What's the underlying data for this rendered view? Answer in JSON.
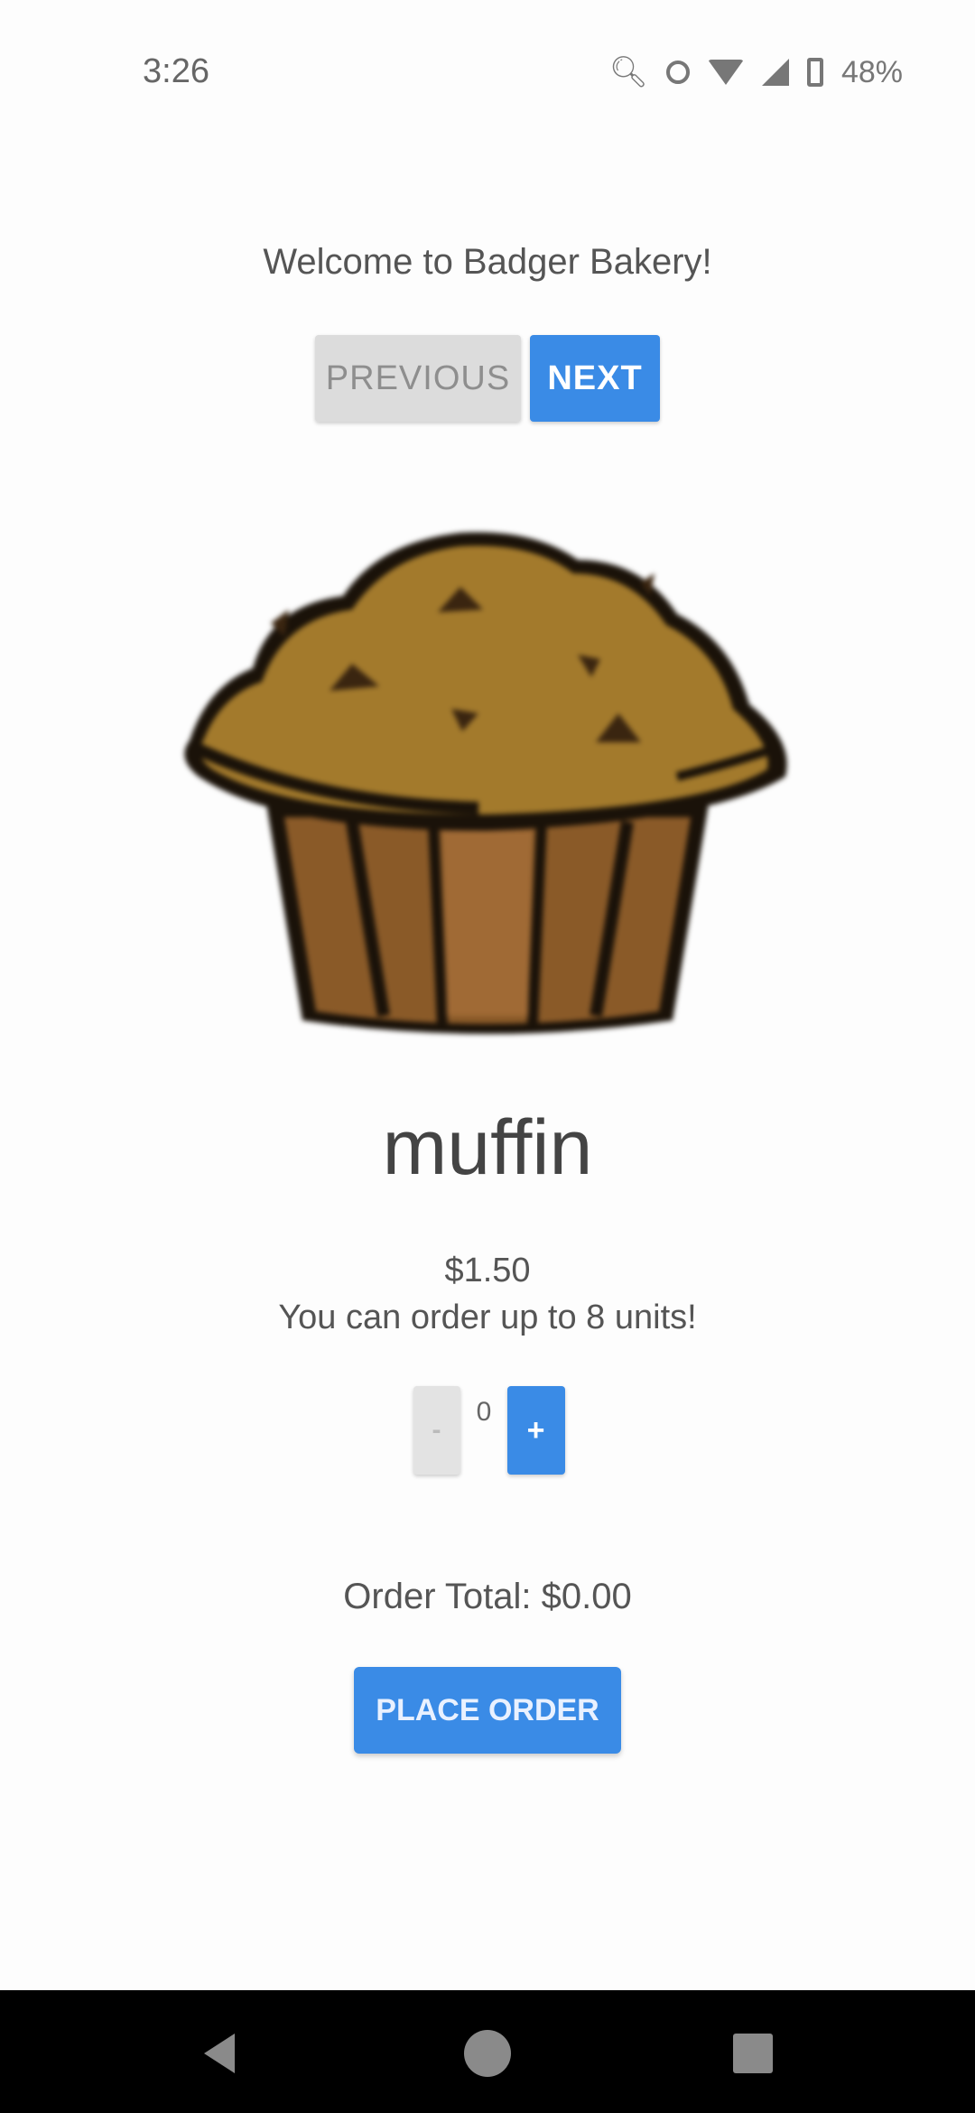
{
  "status_bar": {
    "time": "3:26",
    "battery": "48%",
    "icons": [
      "search-status-icon",
      "circle-status-icon",
      "wifi-icon",
      "signal-icon",
      "battery-icon"
    ]
  },
  "header": {
    "welcome": "Welcome to Badger Bakery!"
  },
  "nav": {
    "previous_label": "PREVIOUS",
    "next_label": "NEXT"
  },
  "item": {
    "image": "muffin-illustration",
    "name": "muffin",
    "price": "$1.50",
    "limit_text": "You can order up to 8 units!"
  },
  "stepper": {
    "minus_label": "-",
    "count": "0",
    "plus_label": "+"
  },
  "order": {
    "total_text": "Order Total: $0.00",
    "place_order_label": "PLACE ORDER"
  },
  "colors": {
    "accent": "#3a8be6",
    "disabled": "#dcdcdc",
    "muffin_top": "#a37a2c",
    "muffin_cup": "#8a5a28"
  }
}
